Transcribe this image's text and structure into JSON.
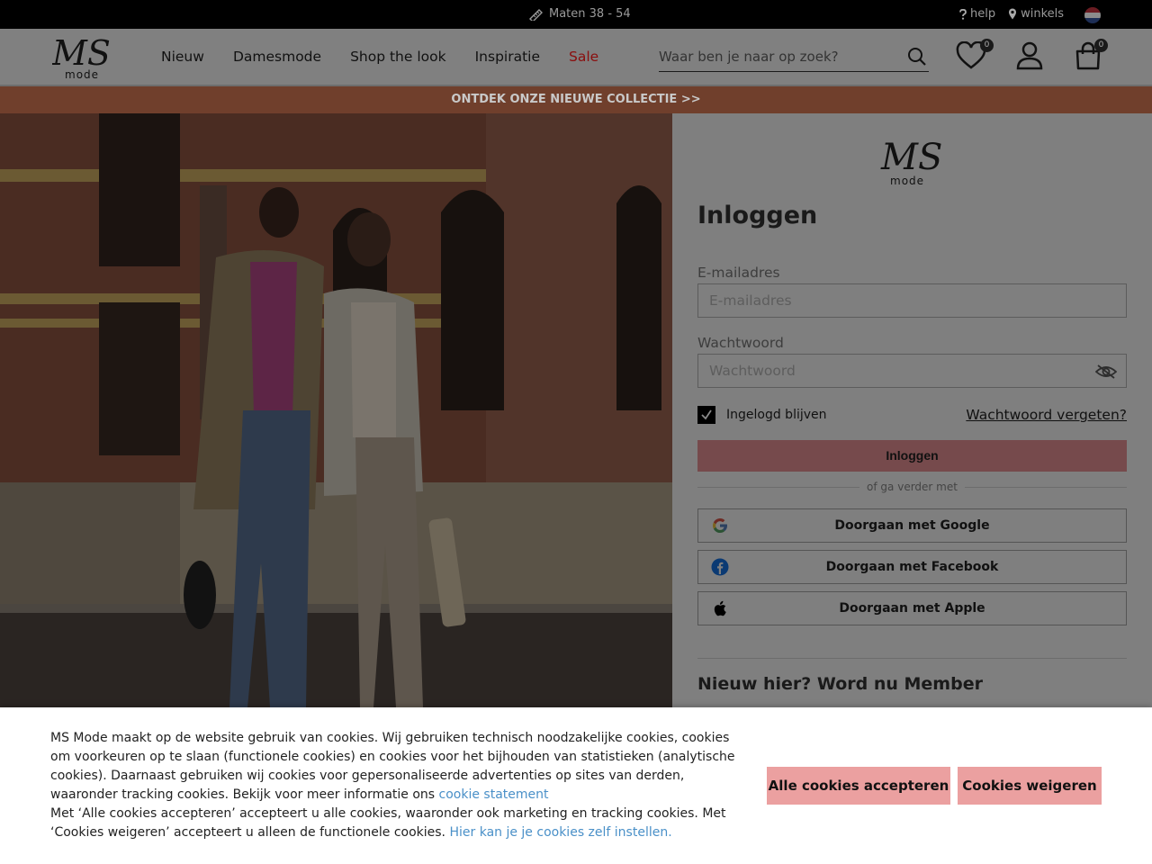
{
  "topbar": {
    "sizes": "Maten 38 - 54",
    "help": "help",
    "stores": "winkels",
    "flag_colors": [
      "#ae1c28",
      "#ffffff",
      "#21468b"
    ]
  },
  "header": {
    "logo_text": "MS",
    "logo_sub": "mode",
    "nav": [
      "Nieuw",
      "Damesmode",
      "Shop the look",
      "Inspiratie"
    ],
    "nav_sale": "Sale",
    "sale_color": "#8a0d0d",
    "search_placeholder": "Waar ben je naar op zoek?",
    "wishlist_count": "0",
    "cart_count": "0"
  },
  "promo": {
    "text": "ONTDEK ONZE NIEUWE COLLECTIE >>",
    "background": "#703f2c"
  },
  "login": {
    "logo_text": "MS",
    "logo_sub": "mode",
    "title": "Inloggen",
    "email_label": "E-mailadres",
    "email_placeholder": "E-mailadres",
    "password_label": "Wachtwoord",
    "password_placeholder": "Wachtwoord",
    "remember_label": "Ingelogd blijven",
    "remember_checked": true,
    "forgot": "Wachtwoord vergeten?",
    "submit": "Inloggen",
    "divider": "of ga verder met",
    "google": "Doorgaan met Google",
    "facebook": "Doorgaan met Facebook",
    "apple": "Doorgaan met Apple",
    "new_here": "Nieuw hier? Word nu Member"
  },
  "cookie": {
    "line1": "MS Mode maakt op de website gebruik van cookies. Wij gebruiken technisch noodzakelijke cookies, cookies om voorkeuren op te slaan (functionele cookies) en cookies voor het bijhouden van statistieken (analytische cookies). Daarnaast gebruiken wij cookies voor gepersonaliseerde advertenties op sites van derden, waaronder tracking cookies. Bekijk voor meer informatie ons ",
    "statement_link": "cookie statement",
    "line2": "Met ‘Alle cookies accepteren’ accepteert u alle cookies, waaronder ook marketing en tracking cookies. Met ‘Cookies weigeren’ accepteert u alleen de functionele cookies. ",
    "settings_link": "Hier kan je je cookies zelf instellen.",
    "accept": "Alle cookies accepteren",
    "decline": "Cookies weigeren",
    "button_color": "#eba0a0",
    "link_color": "#4a90c8"
  }
}
